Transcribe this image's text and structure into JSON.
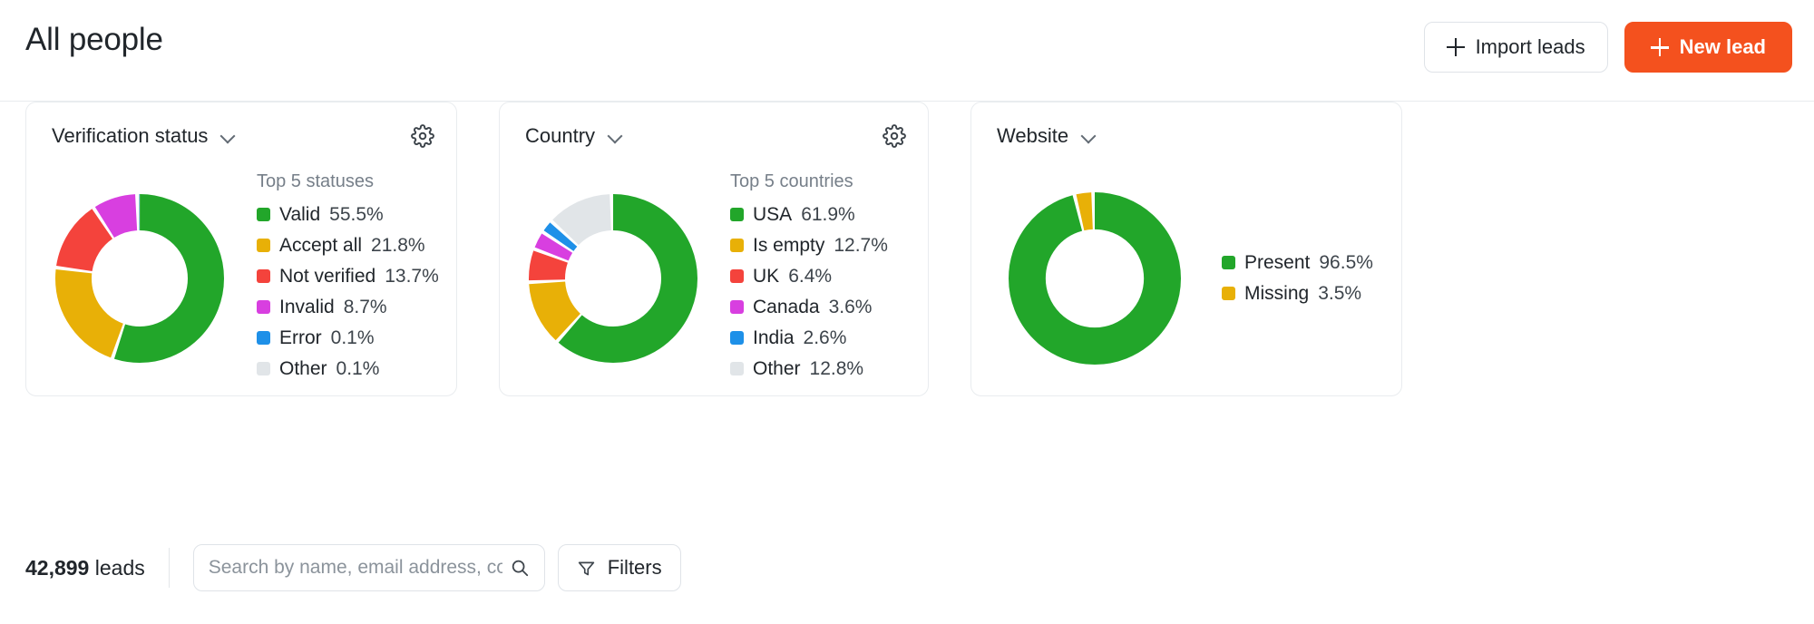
{
  "header": {
    "title": "All people",
    "import_button": "Import leads",
    "new_button": "New lead"
  },
  "colors": {
    "green": "#22a62a",
    "yellow": "#e8b007",
    "red": "#f4433c",
    "magenta": "#d83fe0",
    "blue": "#1e90e8",
    "gray": "#e1e5e8",
    "accent_orange": "#f4511e"
  },
  "cards": [
    {
      "title": "Verification status",
      "has_gear": true,
      "legend_title": "Top 5 statuses",
      "chart_data": {
        "type": "pie",
        "title": "Verification status",
        "categories": [
          "Valid",
          "Accept all",
          "Not verified",
          "Invalid",
          "Error",
          "Other"
        ],
        "values": [
          55.5,
          21.8,
          13.7,
          8.7,
          0.1,
          0.1
        ],
        "value_labels": [
          "55.5%",
          "21.8%",
          "13.7%",
          "8.7%",
          "0.1%",
          "0.1%"
        ],
        "colors": [
          "#22a62a",
          "#e8b007",
          "#f4433c",
          "#d83fe0",
          "#1e90e8",
          "#e1e5e8"
        ],
        "legend_position": "right"
      }
    },
    {
      "title": "Country",
      "has_gear": true,
      "legend_title": "Top 5 countries",
      "chart_data": {
        "type": "pie",
        "title": "Country",
        "categories": [
          "USA",
          "Is empty",
          "UK",
          "Canada",
          "India",
          "Other"
        ],
        "values": [
          61.9,
          12.7,
          6.4,
          3.6,
          2.6,
          12.8
        ],
        "value_labels": [
          "61.9%",
          "12.7%",
          "6.4%",
          "3.6%",
          "2.6%",
          "12.8%"
        ],
        "colors": [
          "#22a62a",
          "#e8b007",
          "#f4433c",
          "#d83fe0",
          "#1e90e8",
          "#e1e5e8"
        ],
        "legend_position": "right"
      }
    },
    {
      "title": "Website",
      "has_gear": false,
      "legend_title": "",
      "chart_data": {
        "type": "pie",
        "title": "Website",
        "categories": [
          "Present",
          "Missing"
        ],
        "values": [
          96.5,
          3.5
        ],
        "value_labels": [
          "96.5%",
          "3.5%"
        ],
        "colors": [
          "#22a62a",
          "#e8b007"
        ],
        "legend_position": "right"
      }
    }
  ],
  "toolbar": {
    "leads_count": "42,899",
    "leads_word": "leads",
    "search_placeholder": "Search by name, email address, co",
    "search_value": "",
    "filters_label": "Filters"
  }
}
